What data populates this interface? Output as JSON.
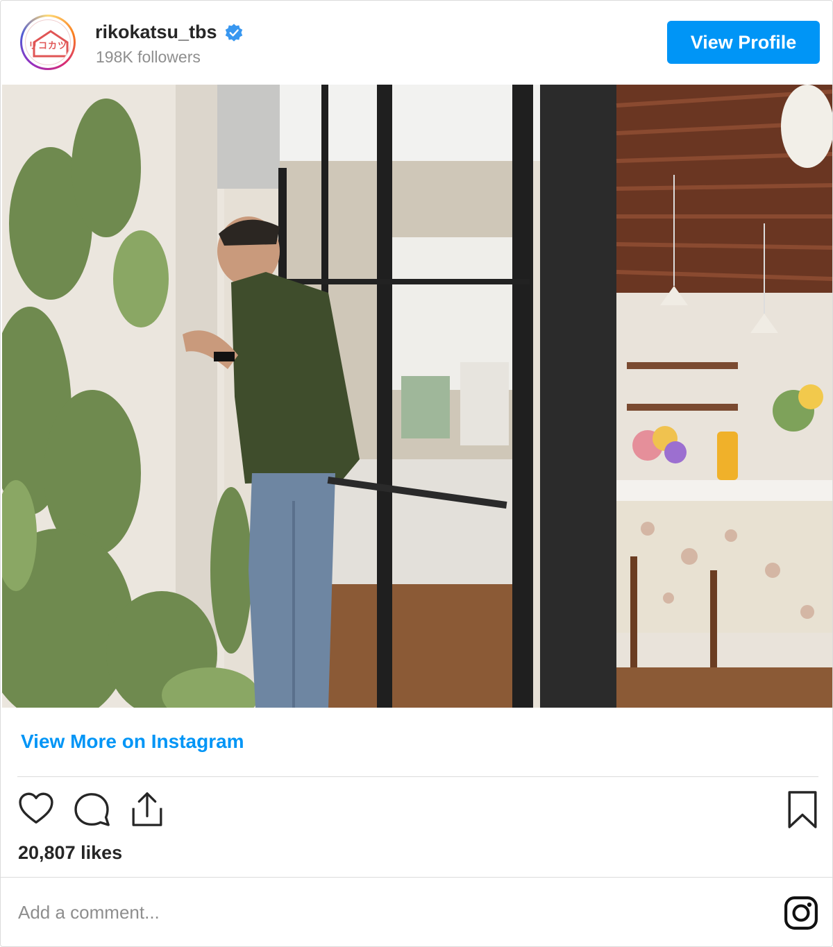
{
  "header": {
    "avatar_text": "リコカツ",
    "username": "rikokatsu_tbs",
    "followers": "198K followers",
    "view_profile_label": "View Profile"
  },
  "post": {
    "view_more_label": "View More on Instagram",
    "likes": "20,807 likes",
    "comment_placeholder": "Add a comment..."
  },
  "icons": {
    "verified": "verified-badge-icon",
    "like": "heart-icon",
    "comment": "comment-bubble-icon",
    "share": "share-icon",
    "save": "bookmark-icon",
    "instagram": "instagram-logo-icon"
  },
  "colors": {
    "accent": "#0095f6",
    "text": "#262626",
    "muted": "#8e8e8e",
    "border": "#dbdbdb"
  }
}
